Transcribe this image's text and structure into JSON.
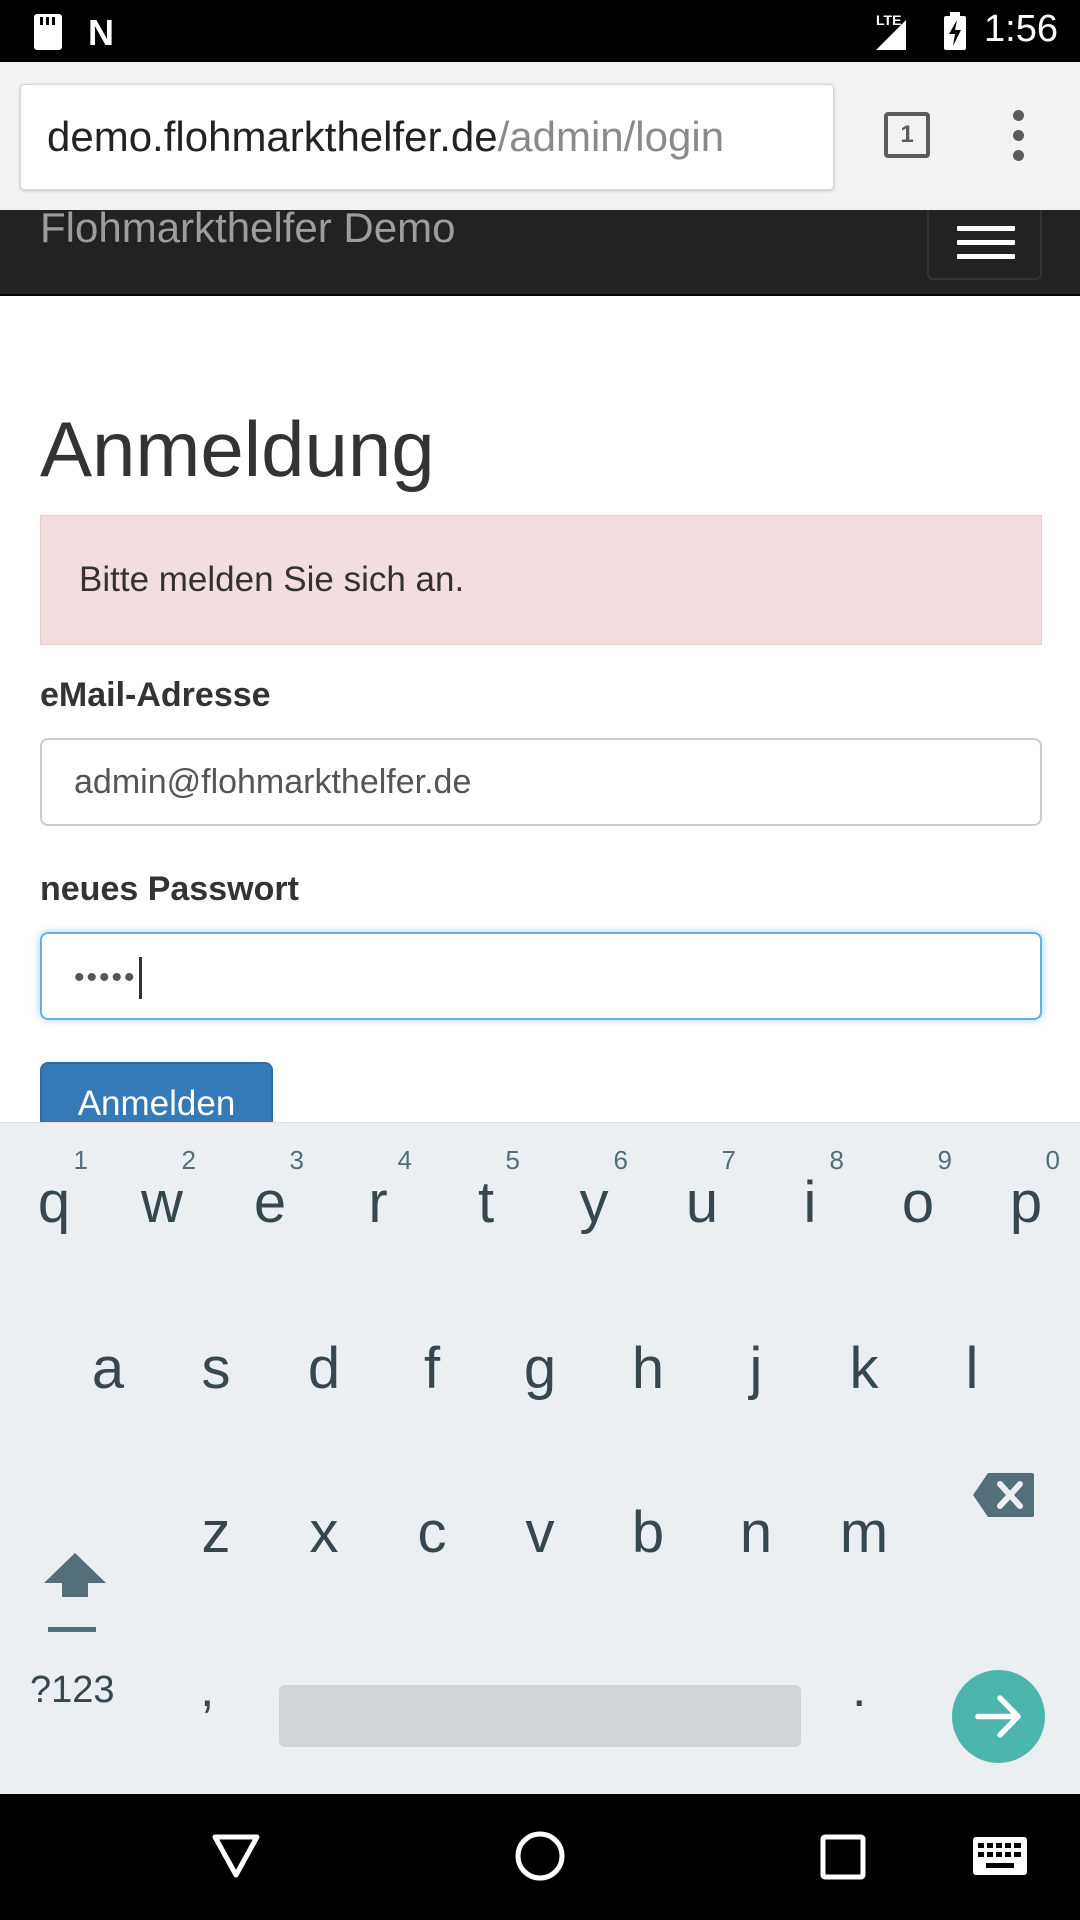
{
  "status_bar": {
    "network": "LTE",
    "time": "1:56"
  },
  "browser": {
    "url_host": "demo.flohmarkthelfer.de",
    "url_path": "/admin/login",
    "tab_count": "1"
  },
  "navbar": {
    "brand": "Flohmarkthelfer Demo"
  },
  "page": {
    "title": "Anmeldung",
    "alert": "Bitte melden Sie sich an.",
    "email_label": "eMail-Adresse",
    "email_value": "admin@flohmarkthelfer.de",
    "password_label": "neues Passwort",
    "password_value": "•••••",
    "submit_label": "Anmelden"
  },
  "keyboard": {
    "row1": [
      {
        "key": "q",
        "hint": "1"
      },
      {
        "key": "w",
        "hint": "2"
      },
      {
        "key": "e",
        "hint": "3"
      },
      {
        "key": "r",
        "hint": "4"
      },
      {
        "key": "t",
        "hint": "5"
      },
      {
        "key": "y",
        "hint": "6"
      },
      {
        "key": "u",
        "hint": "7"
      },
      {
        "key": "i",
        "hint": "8"
      },
      {
        "key": "o",
        "hint": "9"
      },
      {
        "key": "p",
        "hint": "0"
      }
    ],
    "row2": [
      "a",
      "s",
      "d",
      "f",
      "g",
      "h",
      "j",
      "k",
      "l"
    ],
    "row3": [
      "z",
      "x",
      "c",
      "v",
      "b",
      "n",
      "m"
    ],
    "symbols_label": "?123",
    "comma": ",",
    "period": "."
  },
  "colors": {
    "navbar_bg": "#222222",
    "alert_bg": "#f2dede",
    "button_primary": "#337ab7",
    "focus_border": "#66afe9",
    "enter_key": "#4db6ac"
  },
  "icons": {
    "tabs": "tab-switcher-icon",
    "menu": "more-vert-icon",
    "navbar_toggle": "hamburger-icon",
    "shift": "shift-icon",
    "backspace": "backspace-icon",
    "enter": "arrow-right-icon",
    "back": "back-triangle-icon",
    "home": "home-circle-icon",
    "recents": "recents-square-icon",
    "keyboard": "keyboard-icon"
  }
}
